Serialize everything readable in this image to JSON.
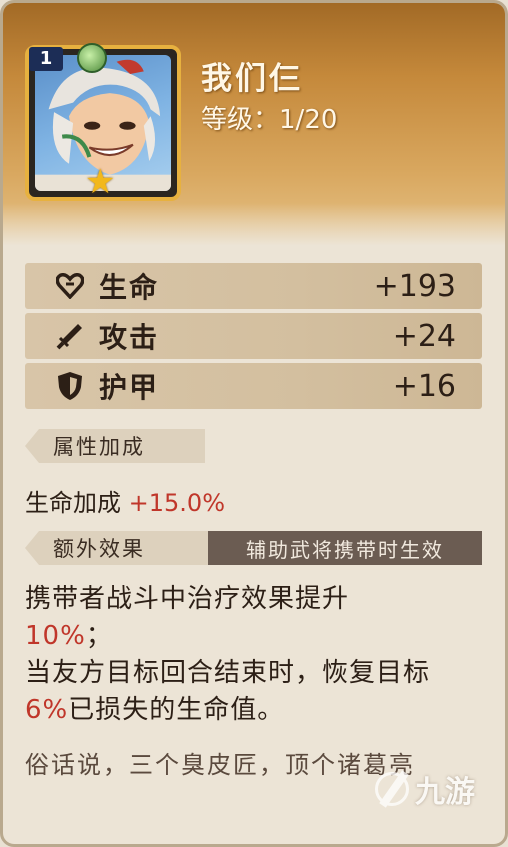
{
  "hero": {
    "level_badge": "1",
    "name": "我们仨",
    "level_label": "等级：",
    "level_value": "1/20",
    "stars": 1,
    "star_icon": "star-icon",
    "element_icon": "leaf-icon"
  },
  "stats": [
    {
      "icon": "heart-icon",
      "label": "生命",
      "value": "+193"
    },
    {
      "icon": "sword-icon",
      "label": "攻击",
      "value": "+24"
    },
    {
      "icon": "shield-icon",
      "label": "护甲",
      "value": "+16"
    }
  ],
  "attribute_section": {
    "title": "属性加成",
    "bonus_label": "生命加成",
    "bonus_value": "+15.0%"
  },
  "extra_section": {
    "title": "额外效果",
    "note": "辅助武将携带时生效",
    "desc_part1": "携带者战斗中治疗效果提升",
    "desc_value1": "10%",
    "desc_part2": "；",
    "desc_part3": "当友方目标回合结束时，恢复目标",
    "desc_value2": "6%",
    "desc_part4": "已损失的生命值。"
  },
  "flavor_text": "俗话说，三个臭皮匠，顶个诸葛亮",
  "watermark": "九游",
  "colors": {
    "header_gold": "#c5893b",
    "frame_gold": "#e7b13f",
    "highlight_red": "#c0362a",
    "stat_bar": "#d3bf9f"
  }
}
